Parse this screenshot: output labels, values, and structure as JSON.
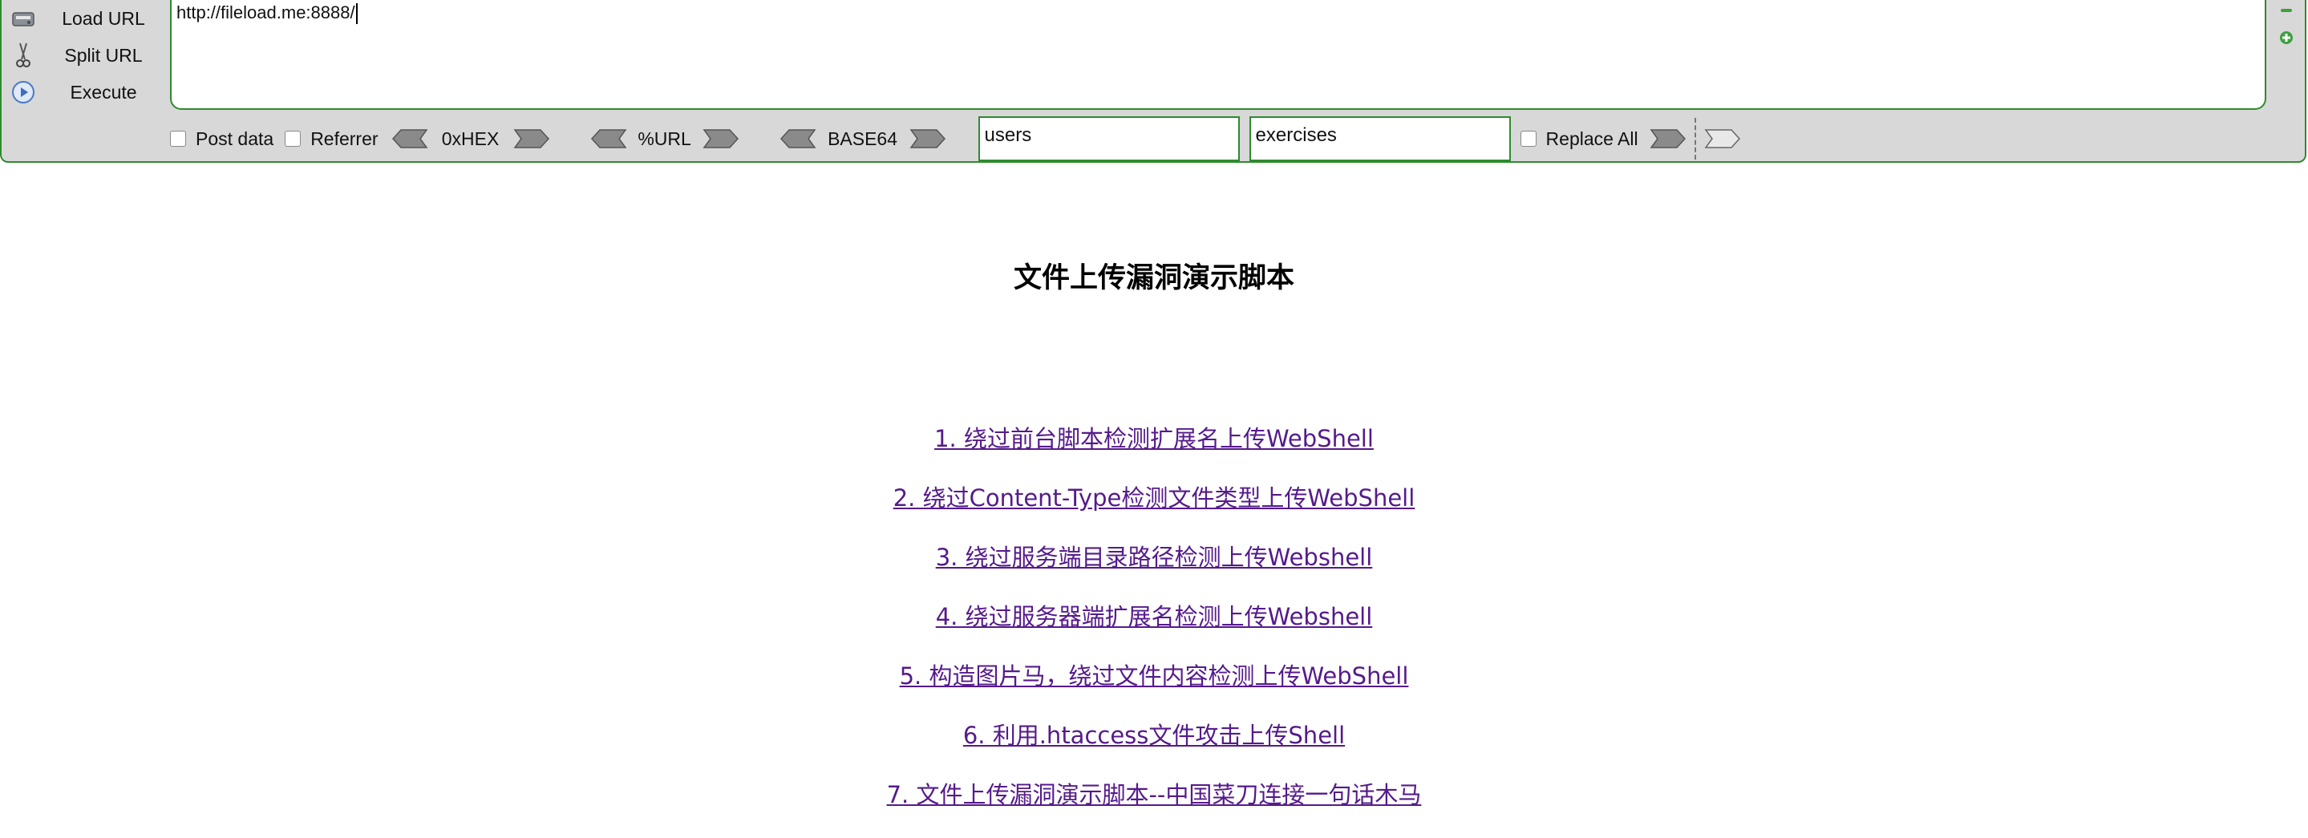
{
  "toolbar": {
    "commands": [
      {
        "label": "Load URL",
        "icon": "load-url-icon"
      },
      {
        "label": "Split URL",
        "icon": "scissors-icon"
      },
      {
        "label": "Execute",
        "icon": "play-icon"
      }
    ],
    "url_value": "http://fileload.me:8888/",
    "post_data_label": "Post data",
    "referrer_label": "Referrer",
    "hex_label": "0xHEX",
    "url_enc_label": "%URL",
    "base64_label": "BASE64",
    "replace_from": "users",
    "replace_to": "exercises",
    "replace_all_label": "Replace All",
    "accent_color": "#2e8b2e"
  },
  "page": {
    "title": "文件上传漏洞演示脚本",
    "links": [
      "1. 绕过前台脚本检测扩展名上传WebShell",
      "2. 绕过Content-Type检测文件类型上传WebShell",
      "3. 绕过服务端目录路径检测上传Webshell",
      "4. 绕过服务器端扩展名检测上传Webshell",
      "5. 构造图片马，绕过文件内容检测上传WebShell",
      "6. 利用.htaccess文件攻击上传Shell",
      "7. 文件上传漏洞演示脚本--中国菜刀连接一句话木马"
    ],
    "link_color": "#551a8b"
  }
}
